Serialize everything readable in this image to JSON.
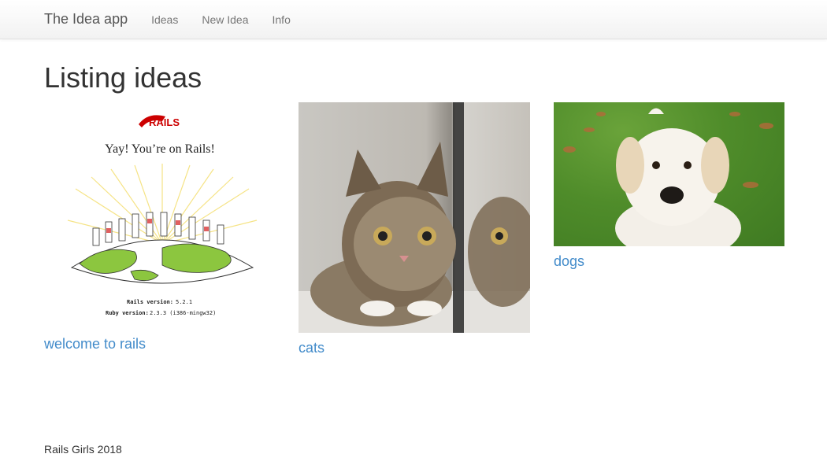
{
  "nav": {
    "brand": "The Idea app",
    "links": [
      "Ideas",
      "New Idea",
      "Info"
    ]
  },
  "page": {
    "title": "Listing ideas"
  },
  "ideas": [
    {
      "name": "welcome to rails",
      "image": {
        "logo_text": "RAILS",
        "heading": "Yay! You’re on Rails!",
        "rails_version_label": "Rails version:",
        "rails_version": "5.2.1",
        "ruby_version_label": "Ruby version:",
        "ruby_version": "2.3.3 (i386-mingw32)"
      }
    },
    {
      "name": "cats"
    },
    {
      "name": "dogs"
    }
  ],
  "footer": {
    "text": "Rails Girls 2018"
  },
  "colors": {
    "link": "#428bca",
    "rails_red": "#cc0000",
    "globe_green": "#8cc63f"
  }
}
